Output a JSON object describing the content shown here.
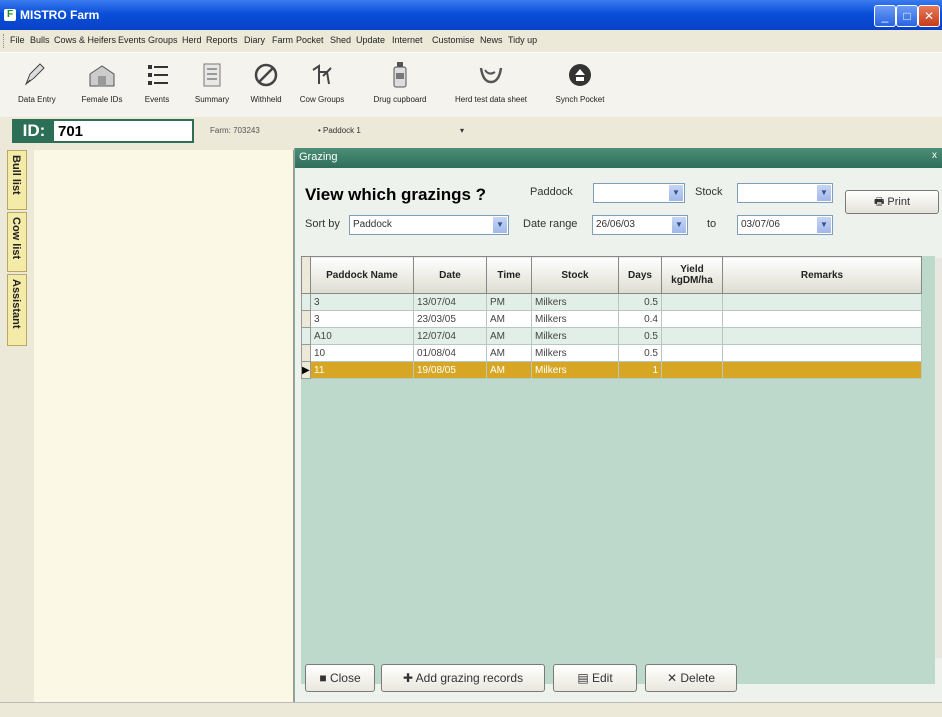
{
  "window": {
    "title": "MISTRO Farm"
  },
  "menu": [
    "File",
    "Bulls",
    "Cows & Heifers",
    "Events",
    "Groups",
    "Herd",
    "Reports",
    "Diary",
    "Farm",
    "Pocket",
    "Shed",
    "Update",
    "Internet",
    "Customise",
    "News",
    "Tidy up"
  ],
  "toolbar": [
    {
      "label": "Data Entry",
      "icon": "pencil-icon"
    },
    {
      "label": "Female IDs",
      "icon": "barn-icon"
    },
    {
      "label": "Events",
      "icon": "list-icon"
    },
    {
      "label": "Summary",
      "icon": "document-icon"
    },
    {
      "label": "Withheld",
      "icon": "prohibited-icon"
    },
    {
      "label": "Cow Groups",
      "icon": "cow-groups-icon"
    },
    {
      "label": "Drug cupboard",
      "icon": "bottle-icon"
    },
    {
      "label": "Herd test data sheet",
      "icon": "horn-icon"
    },
    {
      "label": "Synch Pocket",
      "icon": "sync-icon"
    }
  ],
  "idbar": {
    "id_label": "ID:",
    "id_value": "701",
    "farm": "Farm: 703243",
    "paddock": "• Paddock 1",
    "paddock_drop": "▾"
  },
  "sidetabs": [
    "Bull list",
    "Cow list",
    "Assistant"
  ],
  "panel": {
    "title": "Grazing",
    "close_x": "x",
    "question": "View which grazings ?",
    "paddock_label": "Paddock",
    "paddock_value": "",
    "stock_label": "Stock",
    "stock_value": "",
    "sortby_label": "Sort by",
    "sortby_value": "Paddock",
    "daterange_label": "Date range",
    "date_from": "26/06/03",
    "to_label": "to",
    "date_to": "03/07/06",
    "print_label": "Print"
  },
  "table": {
    "headers": [
      "Paddock Name",
      "Date",
      "Time",
      "Stock",
      "Days",
      "Yield kgDM/ha",
      "Remarks"
    ],
    "rows": [
      [
        "3",
        "13/07/04",
        "PM",
        "Milkers",
        "0.5",
        "",
        ""
      ],
      [
        "3",
        "23/03/05",
        "AM",
        "Milkers",
        "0.4",
        "",
        ""
      ],
      [
        "A10",
        "12/07/04",
        "AM",
        "Milkers",
        "0.5",
        "",
        ""
      ],
      [
        "10",
        "01/08/04",
        "AM",
        "Milkers",
        "0.5",
        "",
        ""
      ],
      [
        "11",
        "19/08/05",
        "AM",
        "Milkers",
        "1",
        "",
        ""
      ]
    ],
    "selected_row": 4
  },
  "buttons": {
    "close": "Close",
    "add": "Add grazing records",
    "edit": "Edit",
    "delete": "Delete"
  },
  "colors": {
    "header_green": "#2f6e5a",
    "selected_row": "#d7a625",
    "grid_bg": "#bdd9cc"
  }
}
